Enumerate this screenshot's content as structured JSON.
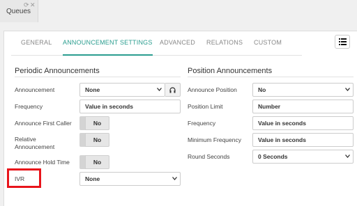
{
  "window_tab": {
    "title": "Queues",
    "icons": [
      "refresh-icon",
      "close-icon"
    ]
  },
  "tabs": [
    {
      "label": "GENERAL",
      "active": false
    },
    {
      "label": "ANNOUNCEMENT SETTINGS",
      "active": true
    },
    {
      "label": "ADVANCED",
      "active": false
    },
    {
      "label": "RELATIONS",
      "active": false
    },
    {
      "label": "CUSTOM",
      "active": false
    }
  ],
  "menu_icon": "list-icon",
  "periodic": {
    "title": "Periodic Announcements",
    "announcement": {
      "label": "Announcement",
      "value": "None",
      "addon_icon": "headphones-icon"
    },
    "frequency": {
      "label": "Frequency",
      "placeholder": "Value in seconds"
    },
    "announce_first_caller": {
      "label": "Announce First Caller",
      "value": "No"
    },
    "relative_announcement": {
      "label": "Relative Announcement",
      "value": "No"
    },
    "announce_hold_time": {
      "label": "Announce Hold Time",
      "value": "No"
    },
    "ivr": {
      "label": "IVR",
      "value": "None"
    }
  },
  "position": {
    "title": "Position Announcements",
    "announce_position": {
      "label": "Announce Position",
      "value": "No"
    },
    "position_limit": {
      "label": "Position Limit",
      "placeholder": "Number"
    },
    "frequency": {
      "label": "Frequency",
      "placeholder": "Value in seconds"
    },
    "minimum_frequency": {
      "label": "Minimum Frequency",
      "placeholder": "Value in seconds"
    },
    "round_seconds": {
      "label": "Round Seconds",
      "value": "0 Seconds"
    }
  },
  "colors": {
    "accent": "#2a9d8f",
    "highlight": "#e8141b"
  }
}
